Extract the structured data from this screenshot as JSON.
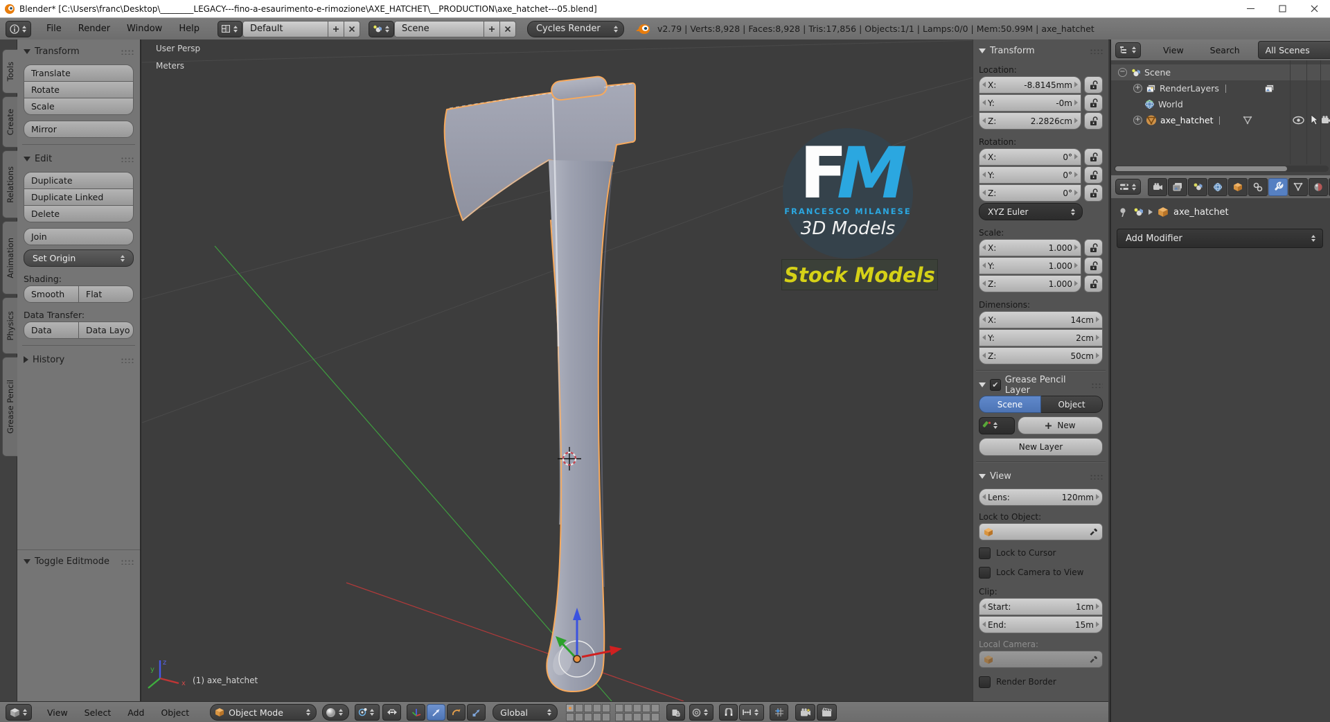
{
  "window": {
    "title": "Blender* [C:\\Users\\franc\\Desktop\\________LEGACY---fino-a-esaurimento-e-rimozione\\AXE_HATCHET\\__PRODUCTION\\axe_hatchet---05.blend]"
  },
  "info_bar": {
    "menus": [
      "File",
      "Render",
      "Window",
      "Help"
    ],
    "layout": "Default",
    "scene": "Scene",
    "engine": "Cycles Render",
    "stats": "v2.79 | Verts:8,928 | Faces:8,928 | Tris:17,856 | Objects:1/1 | Lamps:0/0 | Mem:50.99M | axe_hatchet"
  },
  "tool_shelf": {
    "tabs": [
      "Tools",
      "Create",
      "Relations",
      "Animation",
      "Physics",
      "Grease Pencil"
    ],
    "transform": {
      "title": "Transform",
      "buttons": [
        "Translate",
        "Rotate",
        "Scale"
      ],
      "mirror": "Mirror"
    },
    "edit": {
      "title": "Edit",
      "group": [
        "Duplicate",
        "Duplicate Linked",
        "Delete"
      ],
      "join": "Join",
      "set_origin": "Set Origin"
    },
    "shading": {
      "label": "Shading:",
      "smooth": "Smooth",
      "flat": "Flat"
    },
    "data_transfer": {
      "label": "Data Transfer:",
      "data": "Data",
      "data_layout": "Data Layo"
    },
    "history": "History",
    "operator": "Toggle Editmode"
  },
  "viewport": {
    "view_name": "User Persp",
    "unit": "Meters",
    "object_info": "(1) axe_hatchet",
    "axis": {
      "x": "x",
      "y": "y",
      "z": "z"
    }
  },
  "watermark": {
    "f": "F",
    "m": "M",
    "name": "FRANCESCO MILANESE",
    "tagline": "3D Models",
    "badge": "Stock Models",
    "accent_blue": "#2ba7e0",
    "accent_yellow": "#d5d117"
  },
  "n_panel": {
    "transform": {
      "title": "Transform",
      "location": {
        "label": "Location:",
        "rows": [
          {
            "label": "X:",
            "value": "-8.8145mm"
          },
          {
            "label": "Y:",
            "value": "-0m"
          },
          {
            "label": "Z:",
            "value": "2.2826cm"
          }
        ]
      },
      "rotation": {
        "label": "Rotation:",
        "rows": [
          {
            "label": "X:",
            "value": "0°"
          },
          {
            "label": "Y:",
            "value": "0°"
          },
          {
            "label": "Z:",
            "value": "0°"
          }
        ],
        "mode": "XYZ Euler"
      },
      "scale": {
        "label": "Scale:",
        "rows": [
          {
            "label": "X:",
            "value": "1.000"
          },
          {
            "label": "Y:",
            "value": "1.000"
          },
          {
            "label": "Z:",
            "value": "1.000"
          }
        ]
      },
      "dimensions": {
        "label": "Dimensions:",
        "rows": [
          {
            "label": "X:",
            "value": "14cm"
          },
          {
            "label": "Y:",
            "value": "2cm"
          },
          {
            "label": "Z:",
            "value": "50cm"
          }
        ]
      }
    },
    "grease_pencil": {
      "title": "Grease Pencil Layer",
      "scene": "Scene",
      "object": "Object",
      "new": "New",
      "new_layer": "New Layer"
    },
    "view": {
      "title": "View",
      "lens": {
        "label": "Lens:",
        "value": "120mm"
      },
      "lock_to_object": "Lock to Object:",
      "lock_to_cursor": "Lock to Cursor",
      "lock_camera": "Lock Camera to View",
      "clip": {
        "label": "Clip:",
        "start": {
          "label": "Start:",
          "value": "1cm"
        },
        "end": {
          "label": "End:",
          "value": "15m"
        }
      },
      "local_camera": "Local Camera:",
      "render_border": "Render Border"
    }
  },
  "outliner": {
    "menus": [
      "View",
      "Search"
    ],
    "filter": "All Scenes",
    "items": [
      "Scene",
      "RenderLayers",
      "World",
      "axe_hatchet"
    ]
  },
  "properties": {
    "breadcrumb": "axe_hatchet",
    "add_modifier": "Add Modifier"
  },
  "view3d_header": {
    "menus": [
      "View",
      "Select",
      "Add",
      "Object"
    ],
    "mode": "Object Mode",
    "orientation": "Global"
  }
}
